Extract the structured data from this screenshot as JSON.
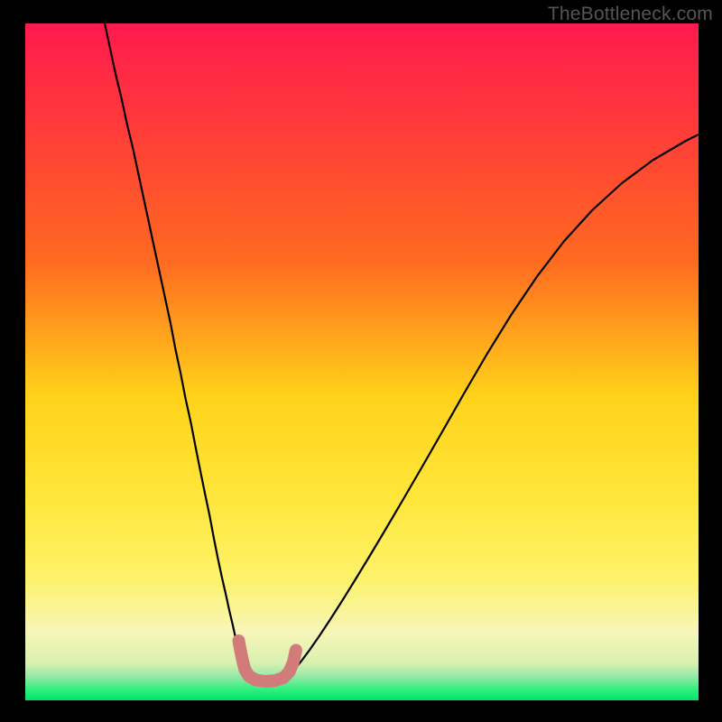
{
  "credit": "TheBottleneck.com",
  "chart_data": {
    "type": "line",
    "title": "",
    "xlabel": "",
    "ylabel": "",
    "xlim": [
      0,
      100
    ],
    "ylim": [
      0,
      100
    ],
    "gradient_stops": [
      {
        "pos": 0.0,
        "color": "#ff1a4e"
      },
      {
        "pos": 0.15,
        "color": "#ff3a3a"
      },
      {
        "pos": 0.35,
        "color": "#ff6a20"
      },
      {
        "pos": 0.55,
        "color": "#ffd21a"
      },
      {
        "pos": 0.7,
        "color": "#ffe63a"
      },
      {
        "pos": 0.82,
        "color": "#fdf26a"
      },
      {
        "pos": 0.9,
        "color": "#f7f6b8"
      },
      {
        "pos": 0.945,
        "color": "#d9f0b0"
      },
      {
        "pos": 0.965,
        "color": "#95e8a8"
      },
      {
        "pos": 0.985,
        "color": "#2bf07a"
      },
      {
        "pos": 1.0,
        "color": "#00e56e"
      }
    ],
    "series": [
      {
        "name": "left-curve",
        "type": "line",
        "x": [
          11.8,
          12.6,
          13.4,
          14.3,
          15.1,
          16.0,
          16.8,
          17.6,
          18.4,
          19.2,
          20.0,
          20.8,
          21.6,
          22.3,
          23.1,
          23.8,
          24.6,
          25.3,
          26.0,
          26.7,
          27.4,
          28.0,
          28.6,
          29.2,
          29.8,
          30.3,
          30.8,
          31.2,
          31.6,
          31.9,
          32.2,
          32.4,
          32.5,
          32.6
        ],
        "y": [
          100.0,
          96.3,
          92.6,
          88.9,
          85.2,
          81.5,
          77.8,
          74.1,
          70.4,
          66.7,
          63.0,
          59.3,
          55.6,
          51.9,
          48.2,
          44.6,
          41.0,
          37.4,
          33.9,
          30.5,
          27.2,
          24.0,
          21.0,
          18.2,
          15.6,
          13.3,
          11.2,
          9.4,
          7.9,
          6.7,
          5.7,
          4.9,
          4.3,
          3.8
        ]
      },
      {
        "name": "right-curve",
        "type": "line",
        "x": [
          39.2,
          40.0,
          41.0,
          42.2,
          43.6,
          45.2,
          47.0,
          49.0,
          51.2,
          53.6,
          56.2,
          59.0,
          62.0,
          65.2,
          68.6,
          72.2,
          76.0,
          80.0,
          84.2,
          88.6,
          93.2,
          98.0,
          100.0
        ],
        "y": [
          3.8,
          4.6,
          5.8,
          7.4,
          9.4,
          11.8,
          14.6,
          17.8,
          21.4,
          25.4,
          29.8,
          34.6,
          39.8,
          45.4,
          51.2,
          57.0,
          62.6,
          67.8,
          72.4,
          76.4,
          79.8,
          82.6,
          83.6
        ]
      },
      {
        "name": "bottom-highlight",
        "type": "line",
        "color": "#d27b7b",
        "width": 14,
        "x": [
          31.7,
          32.0,
          32.3,
          32.6,
          33.2,
          34.2,
          35.6,
          37.0,
          38.3,
          39.2,
          39.8,
          40.2
        ],
        "y": [
          8.8,
          7.2,
          5.8,
          4.6,
          3.6,
          3.0,
          2.8,
          2.9,
          3.3,
          4.2,
          5.6,
          7.4
        ]
      }
    ]
  }
}
